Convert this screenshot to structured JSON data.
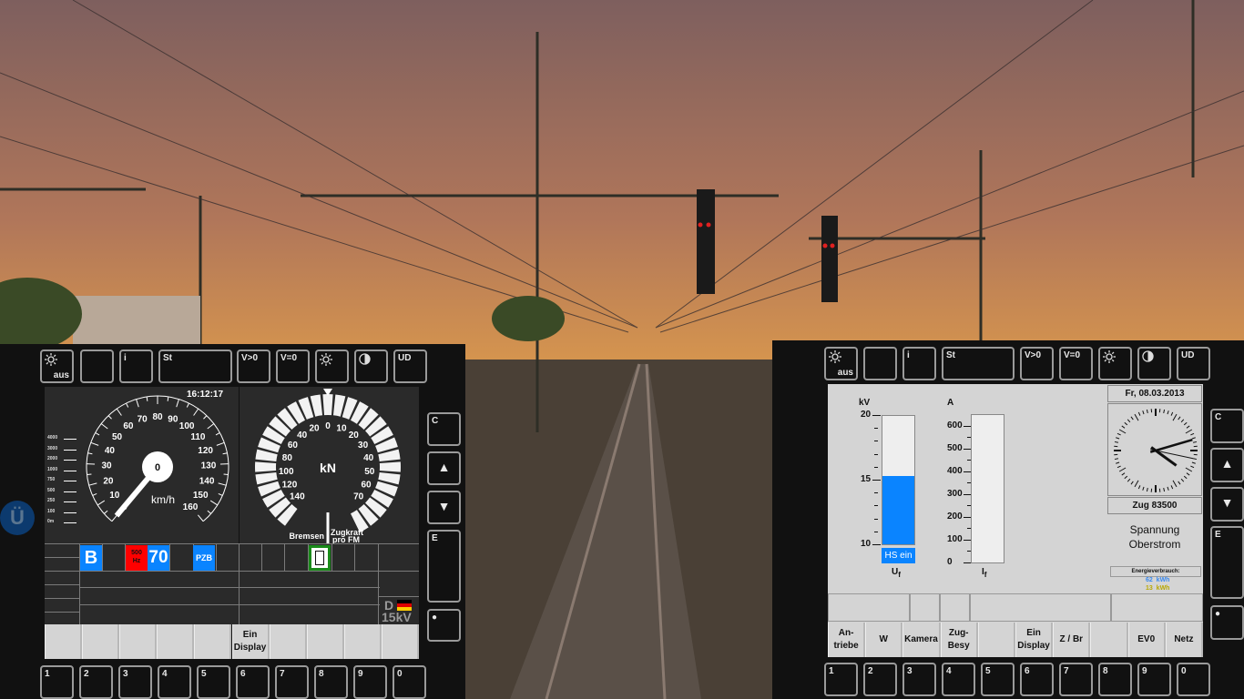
{
  "left_panel": {
    "top_buttons": [
      {
        "icon": "brightness-icon",
        "label": "",
        "sub": "aus"
      },
      {
        "label": ""
      },
      {
        "label": "i"
      },
      {
        "label": "St"
      },
      {
        "label": "V>0"
      },
      {
        "label": "V=0"
      },
      {
        "icon": "brightness-icon",
        "label": ""
      },
      {
        "icon": "contrast-icon",
        "label": ""
      },
      {
        "label": "UD"
      }
    ],
    "side_buttons": [
      "C",
      "▲",
      "▼",
      "E",
      "●"
    ],
    "number_buttons": [
      "1",
      "2",
      "3",
      "4",
      "5",
      "6",
      "7",
      "8",
      "9",
      "0"
    ],
    "time": "16:12:17",
    "speed": {
      "value": "0",
      "unit": "km/h",
      "max": 160,
      "current": 0,
      "tick_labels": [
        "0",
        "10",
        "20",
        "30",
        "40",
        "50",
        "60",
        "70",
        "80",
        "90",
        "100",
        "110",
        "120",
        "130",
        "140",
        "150",
        "160"
      ]
    },
    "distance_scale": [
      "4000",
      "3000",
      "2000",
      "1000",
      "750",
      "500",
      "250",
      "100",
      "0m"
    ],
    "force": {
      "unit": "kN",
      "brake_labels": [
        "20",
        "40",
        "60",
        "80",
        "100",
        "120",
        "140"
      ],
      "traction_labels": [
        "10",
        "20",
        "30",
        "40",
        "50",
        "60",
        "70"
      ],
      "zero": "0",
      "brake_caption": "Bremsen",
      "traction_caption": "Zugkraft",
      "traction_caption2": "pro FM"
    },
    "indicators": {
      "b": "B",
      "hz_top": "500",
      "hz_bottom": "Hz",
      "speed_limit": "70",
      "pzb": "PZB"
    },
    "country": "D",
    "voltage_system": "15kV",
    "softkeys": [
      "",
      "",
      "",
      "",
      "",
      "Ein Display",
      "",
      "",
      "",
      ""
    ],
    "colors": {
      "blue": "#0a84ff",
      "red": "#ff0000",
      "green": "#1a8a1a"
    }
  },
  "right_panel": {
    "top_buttons": [
      {
        "icon": "brightness-icon",
        "label": "",
        "sub": "aus"
      },
      {
        "label": ""
      },
      {
        "label": "i"
      },
      {
        "label": "St"
      },
      {
        "label": "V>0"
      },
      {
        "label": "V=0"
      },
      {
        "icon": "brightness-icon",
        "label": ""
      },
      {
        "icon": "contrast-icon",
        "label": ""
      },
      {
        "label": "UD"
      }
    ],
    "side_buttons": [
      "C",
      "▲",
      "▼",
      "E",
      "●"
    ],
    "number_buttons": [
      "1",
      "2",
      "3",
      "4",
      "5",
      "6",
      "7",
      "8",
      "9",
      "0"
    ],
    "voltage": {
      "unit": "kV",
      "ticks": [
        "20",
        "15",
        "10"
      ],
      "min": 10,
      "max": 20,
      "value": 15.3,
      "status": "HS ein",
      "caption": "U",
      "caption_sub": "f"
    },
    "current": {
      "unit": "A",
      "ticks": [
        "600",
        "500",
        "400",
        "300",
        "200",
        "100",
        "0"
      ],
      "min": 0,
      "max": 650,
      "value": 0,
      "caption": "I",
      "caption_sub": "f"
    },
    "date": "Fr, 08.03.2013",
    "clock_time": "16:12:17",
    "train": "Zug 83500",
    "mode_line1": "Spannung",
    "mode_line2": "Oberstrom",
    "energy_label": "Energieverbrauch:",
    "energy_1": "62  kWh",
    "energy_2": "13  kWh",
    "softkeys": [
      "An-\ntriebe",
      "W",
      "Kamera",
      "Zug-\nBesy",
      "",
      "Ein\nDisplay",
      "Z / Br",
      "",
      "EV0",
      "Netz"
    ]
  },
  "overlay": {
    "u_badge": "Ü"
  }
}
